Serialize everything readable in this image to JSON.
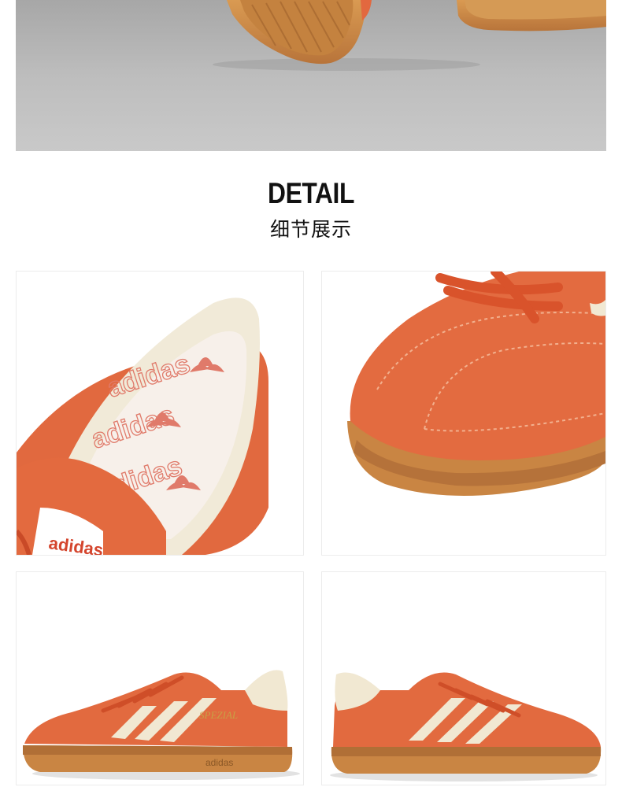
{
  "section": {
    "title_en": "DETAIL",
    "title_zh": "细节展示"
  },
  "photos": {
    "hero": "shoe-soles-on-floor",
    "insole": "insole-closeup",
    "toe": "toe-closeup",
    "side_left": "shoe-side-view-left",
    "side_right": "shoe-side-view-right"
  },
  "logo_text": {
    "insole_print": "adidas",
    "tongue_tag": "adidas",
    "sidewall": "adidas",
    "gold_stamp": "SPEZIAL"
  },
  "colors": {
    "suede_orange": "#e2683f",
    "gum_sole": "#c98543",
    "cream": "#f1e8d2",
    "floor_grey": "#bdbdbd"
  }
}
